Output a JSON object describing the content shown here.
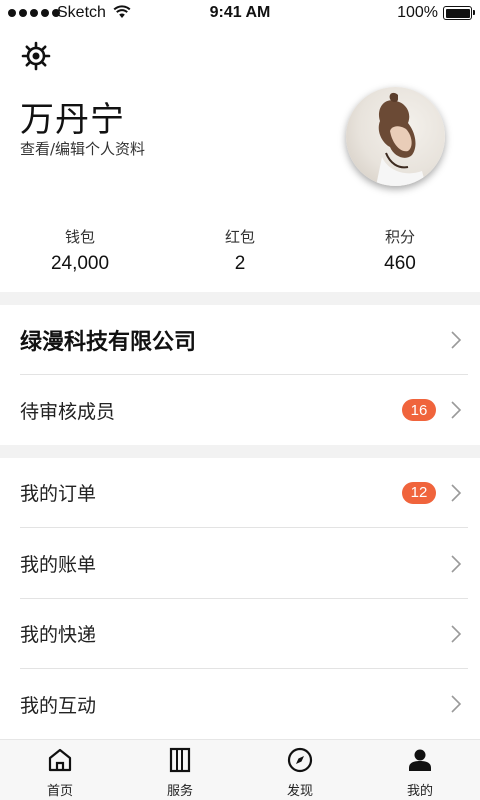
{
  "status_bar": {
    "carrier": "Sketch",
    "time": "9:41 AM",
    "battery_percent": "100%",
    "signal_icon": "signal-dots-icon",
    "wifi_icon": "wifi-icon",
    "battery_icon": "battery-icon"
  },
  "header": {
    "settings_icon": "gear-icon",
    "name": "万丹宁",
    "edit_profile": "查看/编辑个人资料"
  },
  "stats": [
    {
      "label": "钱包",
      "value": "24,000"
    },
    {
      "label": "红包",
      "value": "2"
    },
    {
      "label": "积分",
      "value": "460"
    }
  ],
  "company": {
    "name": "绿漫科技有限公司",
    "pending": {
      "label": "待审核成员",
      "badge": "16"
    }
  },
  "menu": [
    {
      "label": "我的订单",
      "badge": "12"
    },
    {
      "label": "我的账单"
    },
    {
      "label": "我的快递"
    },
    {
      "label": "我的互动"
    }
  ],
  "tab_bar": [
    {
      "label": "首页",
      "icon": "home-icon"
    },
    {
      "label": "服务",
      "icon": "book-icon"
    },
    {
      "label": "发现",
      "icon": "compass-icon"
    },
    {
      "label": "我的",
      "icon": "person-icon",
      "active": true
    }
  ],
  "colors": {
    "badge": "#f0643c",
    "section_gap": "#f2f2f2",
    "tab_bar_bg": "#f7f7f7"
  }
}
